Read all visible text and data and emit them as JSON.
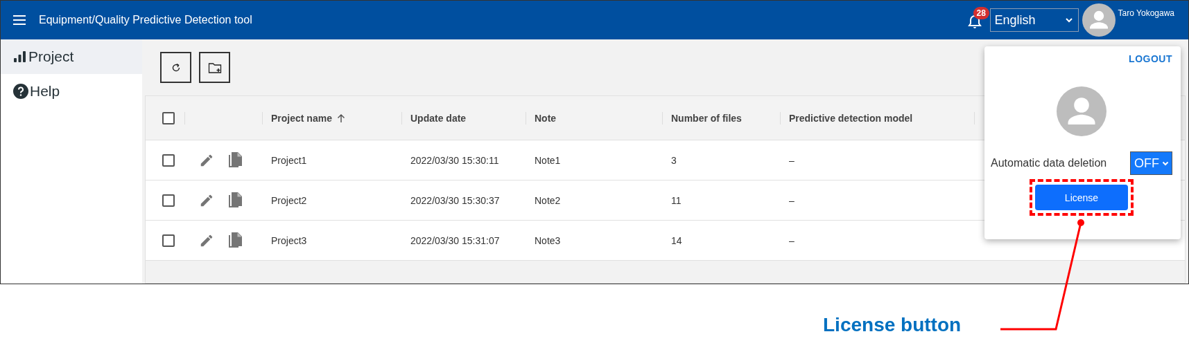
{
  "header": {
    "title": "Equipment/Quality Predictive Detection tool",
    "notification_count": "28",
    "language": "English",
    "user_name": "Taro Yokogawa"
  },
  "sidebar": {
    "items": [
      {
        "label": "Project",
        "kind": "project",
        "selected": true
      },
      {
        "label": "Help",
        "kind": "help",
        "selected": false
      }
    ]
  },
  "table": {
    "header_checked": false,
    "columns": [
      {
        "label": "Project name",
        "sorted": true
      },
      {
        "label": "Update date",
        "sorted": false
      },
      {
        "label": "Note",
        "sorted": false
      },
      {
        "label": "Number of files",
        "sorted": false
      },
      {
        "label": "Predictive detection model",
        "sorted": false
      }
    ],
    "rows": [
      {
        "checked": false,
        "cells": [
          "Project1",
          "2022/03/30 15:30:11",
          "Note1",
          "3",
          "–"
        ]
      },
      {
        "checked": false,
        "cells": [
          "Project2",
          "2022/03/30 15:30:37",
          "Note2",
          "11",
          "–"
        ]
      },
      {
        "checked": false,
        "cells": [
          "Project3",
          "2022/03/30 15:31:07",
          "Note3",
          "14",
          "–"
        ]
      }
    ]
  },
  "user_menu": {
    "logout": "LOGOUT",
    "auto_delete_label": "Automatic data deletion",
    "auto_delete_value": "OFF",
    "license_button": "License"
  },
  "annotation": {
    "label": "License button"
  }
}
